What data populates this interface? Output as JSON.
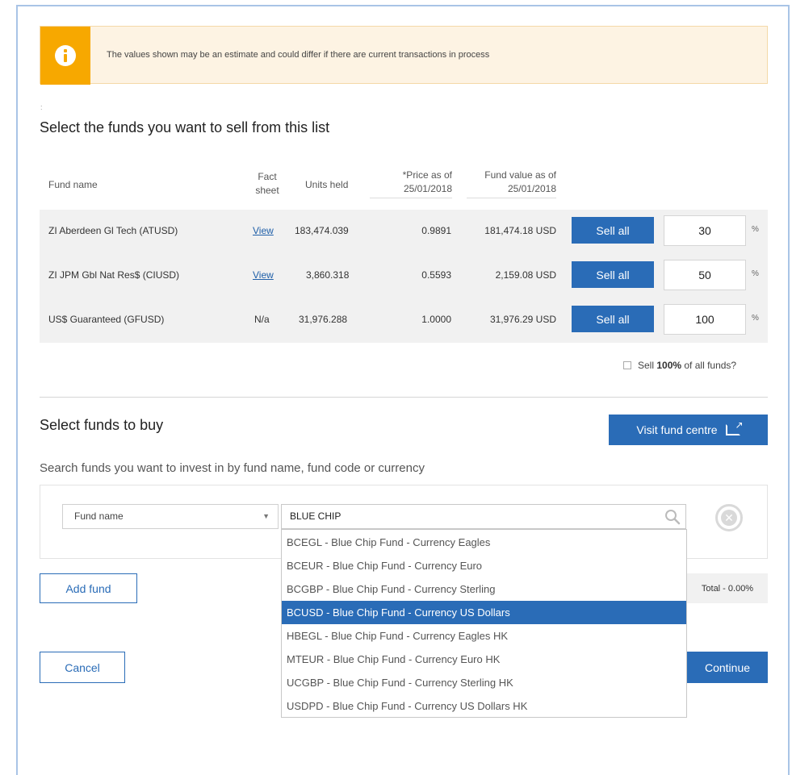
{
  "banner": {
    "text": "The values shown may be an estimate and could differ if there are current transactions in process"
  },
  "sell_section": {
    "marker": ":",
    "title": "Select the funds you want to sell from this list",
    "headers": {
      "fund_name": "Fund name",
      "fact_sheet_1": "Fact",
      "fact_sheet_2": "sheet",
      "units_held": "Units held",
      "price_1": "*Price as of",
      "price_2": "25/01/2018",
      "value_1": "Fund value as of",
      "value_2": "25/01/2018"
    },
    "rows": [
      {
        "name": "ZI Aberdeen Gl Tech (ATUSD)",
        "fact_sheet": "View",
        "units": "183,474.039",
        "price": "0.9891",
        "value": "181,474.18 USD",
        "sell_label": "Sell all",
        "percent": "30",
        "percent_sign": "%"
      },
      {
        "name": "ZI JPM Gbl Nat Res$ (CIUSD)",
        "fact_sheet": "View",
        "units": "3,860.318",
        "price": "0.5593",
        "value": "2,159.08 USD",
        "sell_label": "Sell all",
        "percent": "50",
        "percent_sign": "%"
      },
      {
        "name": "US$ Guaranteed (GFUSD)",
        "fact_sheet": "N/a",
        "units": "31,976.288",
        "price": "1.0000",
        "value": "31,976.29 USD",
        "sell_label": "Sell all",
        "percent": "100",
        "percent_sign": "%"
      }
    ],
    "sell_all_pre": "Sell ",
    "sell_all_bold": "100%",
    "sell_all_post": " of all funds?"
  },
  "buy_section": {
    "title": "Select funds to buy",
    "visit_label": "Visit fund centre",
    "search_label": "Search funds you want to invest in by fund name, fund code or currency",
    "filter_value": "Fund name",
    "search_value": "BLUE CHIP",
    "options": [
      "BCEGL - Blue Chip Fund - Currency Eagles",
      "BCEUR - Blue Chip Fund - Currency Euro",
      "BCGBP - Blue Chip Fund - Currency Sterling",
      "BCUSD - Blue Chip Fund - Currency US Dollars",
      "HBEGL - Blue Chip Fund - Currency Eagles HK",
      "MTEUR - Blue Chip Fund - Currency Euro HK",
      "UCGBP - Blue Chip Fund - Currency Sterling HK",
      "USDPD - Blue Chip Fund - Currency US Dollars HK"
    ],
    "selected_option_index": 3,
    "add_fund_label": "Add fund",
    "total_label": "Total - 0.00%"
  },
  "actions": {
    "cancel_label": "Cancel",
    "continue_label": "Continue"
  },
  "colors": {
    "primary": "#2a6cb7",
    "warning": "#f7a800",
    "banner_bg": "#fdf3e3"
  }
}
